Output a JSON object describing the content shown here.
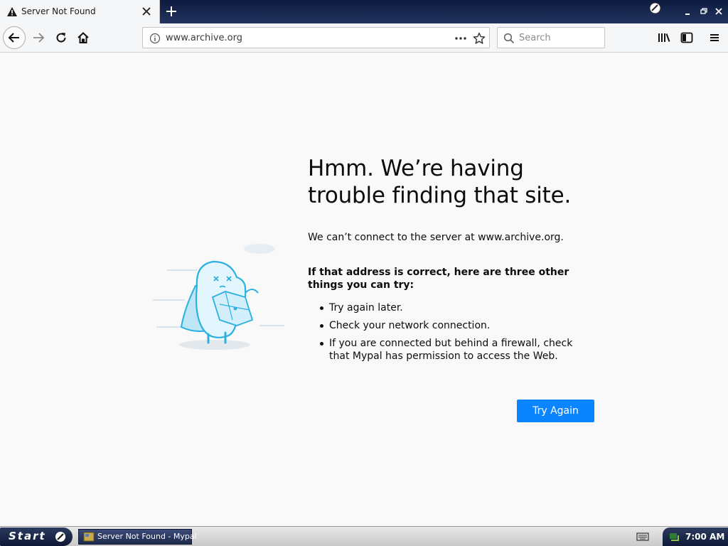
{
  "tab": {
    "title": "Server Not Found"
  },
  "navbar": {
    "url": "www.archive.org",
    "search_placeholder": "Search"
  },
  "error_page": {
    "title": "Hmm. We’re having trouble finding that site.",
    "description": "We can’t connect to the server at www.archive.org.",
    "suggestions_heading": "If that address is correct, here are three other things you can try:",
    "suggestions": [
      "Try again later.",
      "Check your network connection.",
      "If you are connected but behind a firewall, check that Mypal has permission to access the Web."
    ],
    "button_label": "Try Again",
    "accent_color": "#0a84ff"
  },
  "taskbar": {
    "start_label": "Start",
    "task_label": "Server Not Found - Mypal",
    "clock": "7:00 AM"
  },
  "icons": [
    "warning-icon",
    "close-icon",
    "new-tab-icon",
    "back-icon",
    "forward-icon",
    "reload-icon",
    "home-icon",
    "info-icon",
    "more-icon",
    "star-icon",
    "search-icon",
    "library-icon",
    "sidebar-icon",
    "menu-icon"
  ]
}
